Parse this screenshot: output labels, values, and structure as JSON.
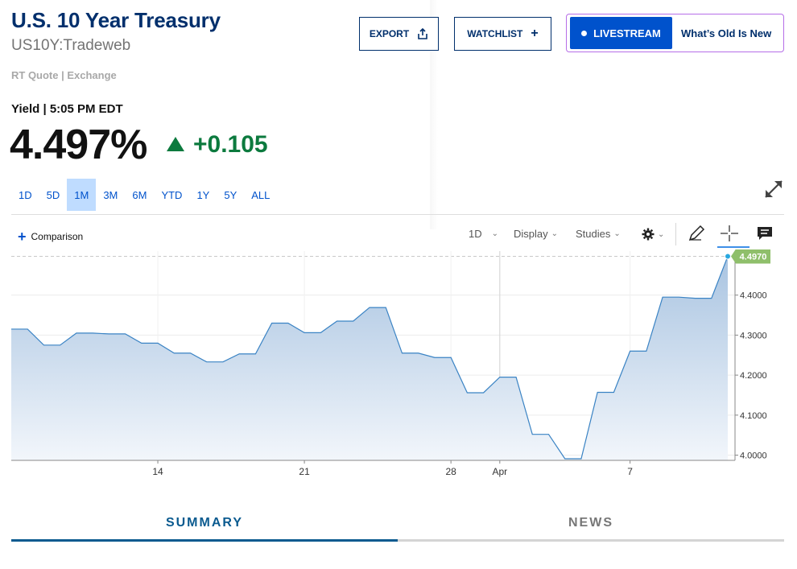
{
  "header": {
    "title": "U.S. 10 Year Treasury",
    "symbol": "US10Y:Tradeweb",
    "quote_source": "RT Quote | Exchange",
    "yield_label": "Yield | 5:05 PM EDT",
    "price": "4.497%",
    "change": "+0.105",
    "change_direction": "up",
    "change_color": "#0c7a3e"
  },
  "actions": {
    "export_label": "EXPORT",
    "watchlist_label": "WATCHLIST",
    "livestream_label": "LIVESTREAM",
    "promo_label": "What’s Old Is New"
  },
  "ranges": [
    "1D",
    "5D",
    "1M",
    "3M",
    "6M",
    "YTD",
    "1Y",
    "5Y",
    "ALL"
  ],
  "selected_range": "1M",
  "toolbar": {
    "comparison_label": "Comparison",
    "interval_label": "1D",
    "display_label": "Display",
    "studies_label": "Studies"
  },
  "tabs": {
    "summary": "SUMMARY",
    "news": "NEWS"
  },
  "colors": {
    "brand_navy": "#002f6c",
    "accent_blue": "#0052cc",
    "line": "#3a83c4",
    "last_price_badge": "#8fbf6b"
  },
  "chart_data": {
    "type": "area",
    "x_ticks": [
      "14",
      "21",
      "28",
      "Apr",
      "7"
    ],
    "y_ticks": [
      "4.0000",
      "4.1000",
      "4.2000",
      "4.3000",
      "4.4000"
    ],
    "ylim": [
      3.987,
      4.51
    ],
    "last_value_label": "4.4970",
    "last_value": 4.497,
    "grid": true,
    "series": [
      {
        "values": [
          4.315,
          4.315,
          4.275,
          4.275,
          4.305,
          4.305,
          4.303,
          4.303,
          4.28,
          4.28,
          4.255,
          4.255,
          4.233,
          4.233,
          4.253,
          4.253,
          4.33,
          4.33,
          4.306,
          4.306,
          4.335,
          4.335,
          4.369,
          4.369,
          4.255,
          4.255,
          4.244,
          4.244,
          4.156,
          4.156,
          4.195,
          4.195,
          4.052,
          4.052,
          3.991,
          3.991,
          4.157,
          4.157,
          4.26,
          4.26,
          4.395,
          4.395,
          4.392,
          4.392,
          4.497
        ]
      }
    ]
  }
}
